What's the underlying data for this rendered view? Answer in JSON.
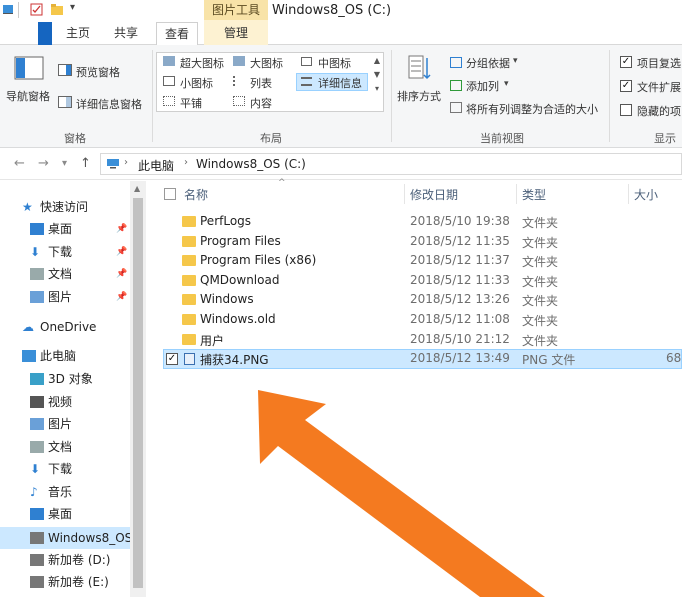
{
  "window": {
    "title": "Windows8_OS (C:)",
    "tools_header": "图片工具"
  },
  "tabs": {
    "home": "主页",
    "share": "共享",
    "view": "查看",
    "manage": "管理"
  },
  "ribbon": {
    "panes": {
      "nav_pane": "导航窗格",
      "preview_pane": "预览窗格",
      "details_pane": "详细信息窗格",
      "group_label": "窗格"
    },
    "layout": {
      "extra_large": "超大图标",
      "large": "大图标",
      "medium": "中图标",
      "small": "小图标",
      "list": "列表",
      "details": "详细信息",
      "tiles": "平铺",
      "content": "内容",
      "group_label": "布局"
    },
    "current_view": {
      "sort_by": "排序方式",
      "group_by": "分组依据",
      "add_columns": "添加列",
      "size_all_columns": "将所有列调整为合适的大小",
      "group_label": "当前视图"
    },
    "show_hide": {
      "item_checkboxes": "项目复选",
      "file_extensions": "文件扩展",
      "hidden_items": "隐藏的项",
      "group_label": "显示"
    }
  },
  "address": {
    "this_pc": "此电脑",
    "drive": "Windows8_OS (C:)"
  },
  "sidebar": {
    "items": [
      {
        "label": "快速访问",
        "icon": "star-icon",
        "pinned": false
      },
      {
        "label": "桌面",
        "icon": "desktop-icon",
        "pinned": true
      },
      {
        "label": "下载",
        "icon": "download-icon",
        "pinned": true
      },
      {
        "label": "文档",
        "icon": "document-icon",
        "pinned": true
      },
      {
        "label": "图片",
        "icon": "picture-icon",
        "pinned": true
      },
      {
        "label": "OneDrive",
        "icon": "cloud-icon",
        "pinned": false
      },
      {
        "label": "此电脑",
        "icon": "computer-icon",
        "pinned": false
      },
      {
        "label": "3D 对象",
        "icon": "cube-icon",
        "pinned": false
      },
      {
        "label": "视频",
        "icon": "video-icon",
        "pinned": false
      },
      {
        "label": "图片",
        "icon": "picture-icon",
        "pinned": false
      },
      {
        "label": "文档",
        "icon": "document-icon",
        "pinned": false
      },
      {
        "label": "下载",
        "icon": "download-icon",
        "pinned": false
      },
      {
        "label": "音乐",
        "icon": "music-icon",
        "pinned": false
      },
      {
        "label": "桌面",
        "icon": "desktop-icon",
        "pinned": false
      },
      {
        "label": "Windows8_OS",
        "icon": "drive-icon",
        "pinned": false
      },
      {
        "label": "新加卷 (D:)",
        "icon": "drive-icon",
        "pinned": false
      },
      {
        "label": "新加卷 (E:)",
        "icon": "drive-icon",
        "pinned": false
      }
    ]
  },
  "columns": {
    "name": "名称",
    "date": "修改日期",
    "type": "类型",
    "size": "大小"
  },
  "files": [
    {
      "name": "PerfLogs",
      "date": "2018/5/10 19:38",
      "type": "文件夹",
      "size": ""
    },
    {
      "name": "Program Files",
      "date": "2018/5/12 11:35",
      "type": "文件夹",
      "size": ""
    },
    {
      "name": "Program Files (x86)",
      "date": "2018/5/12 11:37",
      "type": "文件夹",
      "size": ""
    },
    {
      "name": "QMDownload",
      "date": "2018/5/12 11:33",
      "type": "文件夹",
      "size": ""
    },
    {
      "name": "Windows",
      "date": "2018/5/12 13:26",
      "type": "文件夹",
      "size": ""
    },
    {
      "name": "Windows.old",
      "date": "2018/5/12 11:08",
      "type": "文件夹",
      "size": ""
    },
    {
      "name": "用户",
      "date": "2018/5/10 21:12",
      "type": "文件夹",
      "size": ""
    },
    {
      "name": "捕获34.PNG",
      "date": "2018/5/12 13:49",
      "type": "PNG 文件",
      "size": "68"
    }
  ],
  "colors": {
    "selection": "#cce8ff",
    "folder": "#f5c74a",
    "arrow": "#f47a20",
    "accent": "#1565c0"
  }
}
